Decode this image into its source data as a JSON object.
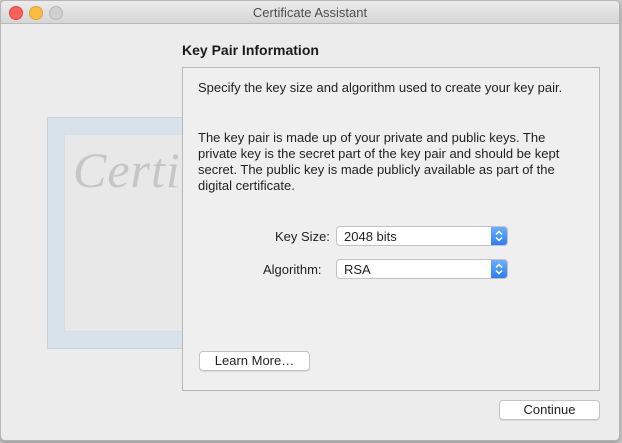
{
  "window": {
    "title": "Certificate Assistant"
  },
  "background": {
    "certificate_watermark": "Certi"
  },
  "section": {
    "heading": "Key Pair Information"
  },
  "description": {
    "paragraph1": "Specify the key size and algorithm used to create your key pair.",
    "paragraph2": "The key pair is made up of your private and public keys. The private key is the secret part of the key pair and should be kept secret. The public key is made publicly available as part of the digital certificate."
  },
  "form": {
    "key_size": {
      "label": "Key Size:",
      "value": "2048 bits"
    },
    "algorithm": {
      "label": "Algorithm:",
      "value": "RSA"
    }
  },
  "buttons": {
    "learn_more": "Learn More…",
    "continue": "Continue"
  },
  "colors": {
    "accent": "#2d7cf3",
    "close": "#fc605c",
    "minimize": "#fdbc40"
  }
}
